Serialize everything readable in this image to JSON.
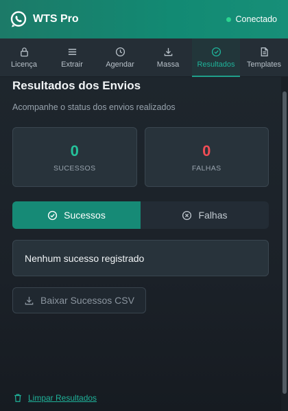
{
  "header": {
    "app_title": "WTS Pro",
    "status_label": "Conectado",
    "status_color": "#2bd48f",
    "logo_icon": "whatsapp-icon"
  },
  "tabs": [
    {
      "label": "Licença",
      "icon": "lock-icon",
      "active": false
    },
    {
      "label": "Extrair",
      "icon": "menu-lines-icon",
      "active": false
    },
    {
      "label": "Agendar",
      "icon": "clock-icon",
      "active": false
    },
    {
      "label": "Massa",
      "icon": "download-icon",
      "active": false
    },
    {
      "label": "Resultados",
      "icon": "check-circle-icon",
      "active": true
    },
    {
      "label": "Templates",
      "icon": "document-icon",
      "active": false
    }
  ],
  "main": {
    "title": "Resultados dos Envios",
    "subtitle": "Acompanhe o status dos envios realizados",
    "stats": {
      "success_value": "0",
      "success_label": "SUCESSOS",
      "fail_value": "0",
      "fail_label": "FALHAS"
    },
    "segments": {
      "success_label": "Sucessos",
      "fail_label": "Falhas",
      "active": "Sucessos"
    },
    "empty_message": "Nenhum sucesso registrado",
    "download_label": "Baixar Sucessos CSV",
    "clear_label": "Limpar Resultados"
  },
  "colors": {
    "accent": "#168a76",
    "success": "#25c19a",
    "fail": "#ef4d55"
  }
}
